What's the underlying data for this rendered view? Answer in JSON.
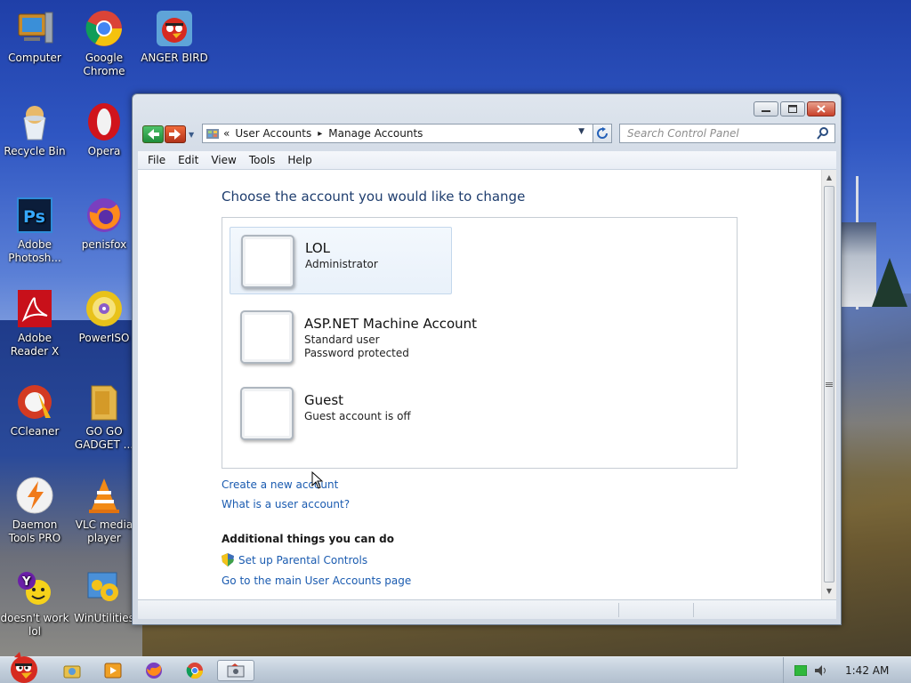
{
  "desktop": {
    "icons": [
      {
        "label": "Computer",
        "icon": "computer-icon"
      },
      {
        "label": "Google Chrome",
        "icon": "chrome-icon"
      },
      {
        "label": "ANGER BIRD",
        "icon": "angry-bird-icon"
      },
      {
        "label": "Recycle Bin",
        "icon": "recycle-bin-icon"
      },
      {
        "label": "Opera",
        "icon": "opera-icon"
      },
      {
        "label": "Adobe Photosh...",
        "icon": "photoshop-icon"
      },
      {
        "label": "penisfox",
        "icon": "firefox-icon"
      },
      {
        "label": "Adobe Reader X",
        "icon": "adobe-reader-icon"
      },
      {
        "label": "PowerISO",
        "icon": "poweriso-icon"
      },
      {
        "label": "CCleaner",
        "icon": "ccleaner-icon"
      },
      {
        "label": "GO GO GADGET ...",
        "icon": "folder-icon"
      },
      {
        "label": "Daemon Tools PRO",
        "icon": "daemon-tools-icon"
      },
      {
        "label": "VLC media player",
        "icon": "vlc-icon"
      },
      {
        "label": "doesn't work lol",
        "icon": "yahoo-messenger-icon"
      },
      {
        "label": "WinUtilities",
        "icon": "winutilities-icon"
      }
    ]
  },
  "window": {
    "address": {
      "prefix": "«",
      "crumb1": "User Accounts",
      "separator": "▸",
      "crumb2": "Manage Accounts"
    },
    "search": {
      "placeholder": "Search Control Panel"
    },
    "menu": [
      "File",
      "Edit",
      "View",
      "Tools",
      "Help"
    ],
    "heading": "Choose the account you would like to change",
    "accounts": [
      {
        "name": "LOL",
        "lines": [
          "Administrator"
        ],
        "selected": true
      },
      {
        "name": "ASP.NET Machine Account",
        "lines": [
          "Standard user",
          "Password protected"
        ],
        "selected": false
      },
      {
        "name": "Guest",
        "lines": [
          "Guest account is off"
        ],
        "selected": false
      }
    ],
    "links": {
      "create": "Create a new account",
      "what": "What is a user account?"
    },
    "additional": {
      "title": "Additional things you can do",
      "parental": "Set up Parental Controls",
      "main_page": "Go to the main User Accounts page"
    }
  },
  "taskbar": {
    "clock": "1:42 AM",
    "items": [
      "explorer-icon",
      "media-player-icon",
      "firefox-icon",
      "chrome-icon",
      "control-panel-icon"
    ]
  },
  "colors": {
    "link": "#1a5bb0",
    "heading": "#1e3d6e"
  }
}
